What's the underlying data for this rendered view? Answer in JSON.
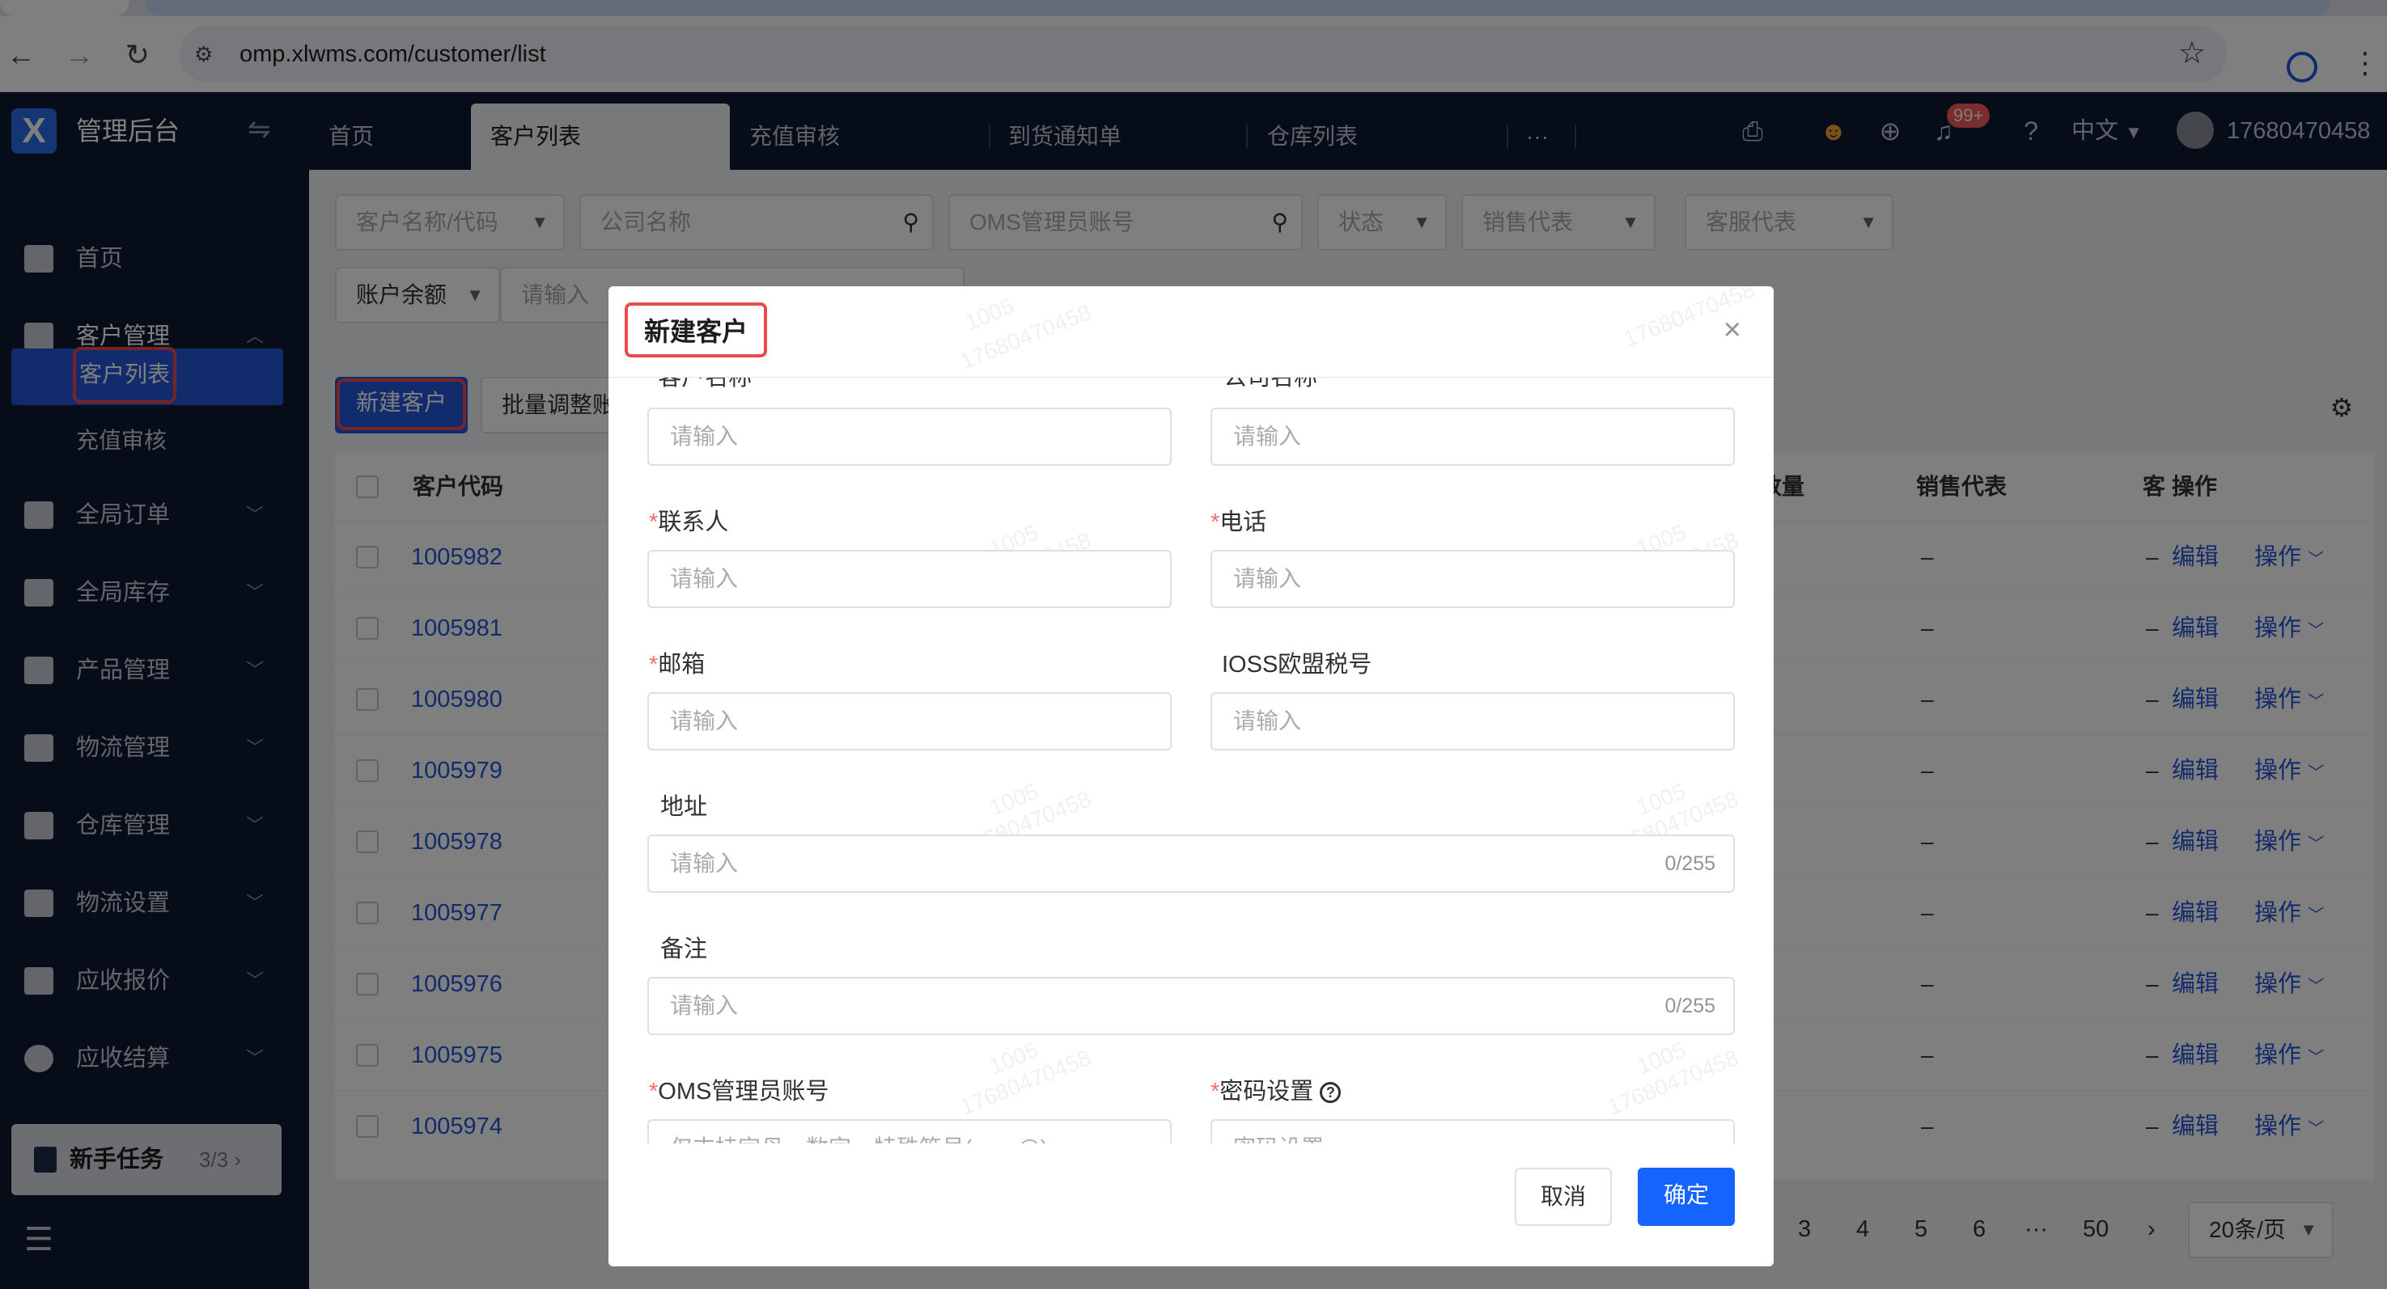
{
  "browser": {
    "url": "omp.xlwms.com/customer/list"
  },
  "app": {
    "logo": "X",
    "title": "管理后台",
    "tabs": [
      "首页",
      "客户列表",
      "充值审核",
      "到货通知单",
      "仓库列表"
    ],
    "more": "···",
    "notification_badge": "99+",
    "language": "中文",
    "username": "17680470458"
  },
  "sidebar": {
    "items": [
      {
        "label": "首页",
        "icon": "home-icon"
      },
      {
        "label": "客户管理",
        "icon": "users-icon"
      },
      {
        "label": "全局订单",
        "icon": "clipboard-icon"
      },
      {
        "label": "全局库存",
        "icon": "warehouse-icon"
      },
      {
        "label": "产品管理",
        "icon": "bag-icon"
      },
      {
        "label": "物流管理",
        "icon": "truck-icon"
      },
      {
        "label": "仓库管理",
        "icon": "home-gear-icon"
      },
      {
        "label": "物流设置",
        "icon": "box-gear-icon"
      },
      {
        "label": "应收报价",
        "icon": "document-icon"
      },
      {
        "label": "应收结算",
        "icon": "coin-icon"
      }
    ],
    "subitems": [
      "客户列表",
      "充值审核"
    ],
    "newbie": {
      "label": "新手任务",
      "count": "3/3 ›"
    }
  },
  "filters": {
    "customer_name": "客户名称/代码",
    "company_name": "公司名称",
    "oms_account": "OMS管理员账号",
    "status": "状态",
    "sales_rep": "销售代表",
    "service_rep": "客服代表",
    "balance": "账户余额",
    "balance_input": "请输入"
  },
  "actions": {
    "new_customer": "新建客户",
    "batch_adjust": "批量调整账"
  },
  "table": {
    "headers": {
      "code": "客户代码",
      "qty": "数量",
      "sales": "销售代表",
      "service": "客",
      "ops": "操作"
    },
    "rows": [
      {
        "code": "1005982"
      },
      {
        "code": "1005981"
      },
      {
        "code": "1005980"
      },
      {
        "code": "1005979"
      },
      {
        "code": "1005978"
      },
      {
        "code": "1005977"
      },
      {
        "code": "1005976"
      },
      {
        "code": "1005975"
      },
      {
        "code": "1005974"
      }
    ],
    "dash": "–",
    "edit_label": "编辑",
    "op_label": "操作"
  },
  "pagination": {
    "pages": [
      "3",
      "4",
      "5",
      "6"
    ],
    "ellipsis": "···",
    "last": "50",
    "next": "›",
    "page_size": "20条/页"
  },
  "modal": {
    "title": "新建客户",
    "close": "×",
    "fields": {
      "customer_name": {
        "label": "客户名称",
        "placeholder": "请输入"
      },
      "company_name": {
        "label": "公司名称",
        "placeholder": "请输入"
      },
      "contact": {
        "label": "联系人",
        "placeholder": "请输入"
      },
      "phone": {
        "label": "电话",
        "placeholder": "请输入"
      },
      "email": {
        "label": "邮箱",
        "placeholder": "请输入"
      },
      "ioss": {
        "label": "IOSS欧盟税号",
        "placeholder": "请输入"
      },
      "address": {
        "label": "地址",
        "placeholder": "请输入",
        "counter": "0/255"
      },
      "remark": {
        "label": "备注",
        "placeholder": "请输入",
        "counter": "0/255"
      },
      "oms_account": {
        "label": "OMS管理员账号",
        "placeholder": "仅支持字母、数字、特殊符号(_ - . @)"
      },
      "password": {
        "label": "密码设置",
        "placeholder": "密码设置"
      }
    },
    "cancel": "取消",
    "confirm": "确定",
    "watermark_a": "1005",
    "watermark_b": "17680470458"
  },
  "colors": {
    "primary": "#2357d9",
    "sidebar_bg": "#0c1a33",
    "highlight": "#ea4b4b",
    "required": "#f56c6c"
  }
}
